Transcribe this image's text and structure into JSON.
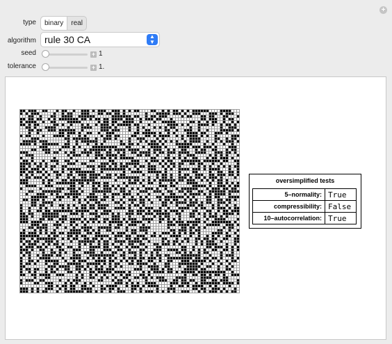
{
  "controls": {
    "type": {
      "label": "type",
      "options": [
        "binary",
        "real"
      ],
      "selected": "binary"
    },
    "algorithm": {
      "label": "algorithm",
      "value": "rule 30 CA"
    },
    "seed": {
      "label": "seed",
      "value": "1",
      "fraction": 0
    },
    "tolerance": {
      "label": "tolerance",
      "value": "1.",
      "fraction": 0
    }
  },
  "tests": {
    "title": "oversimplified tests",
    "rows": [
      {
        "label": "5–normality:",
        "result": "True"
      },
      {
        "label": "compressibility:",
        "result": "False"
      },
      {
        "label": "10–autocorrelation:",
        "result": "True"
      }
    ]
  },
  "grid": {
    "cols": 79,
    "rows": 66,
    "rule": 30,
    "fill": "#000000",
    "empty": "#ffffff"
  }
}
